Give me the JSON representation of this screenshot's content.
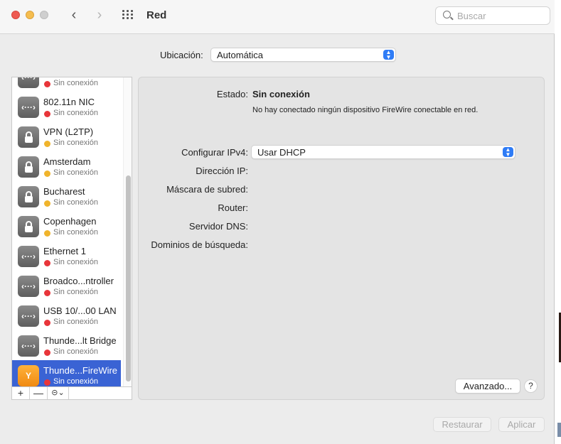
{
  "window": {
    "title": "Red"
  },
  "toolbar": {
    "back": "‹",
    "forward": "›",
    "search_placeholder": "Buscar"
  },
  "location": {
    "label": "Ubicación:",
    "value": "Automática"
  },
  "services": [
    {
      "name": "",
      "status": "Sin conexión",
      "dot": "red",
      "icon": "network"
    },
    {
      "name": "802.11n NIC",
      "status": "Sin conexión",
      "dot": "red",
      "icon": "network"
    },
    {
      "name": "VPN (L2TP)",
      "status": "Sin conexión",
      "dot": "yellow",
      "icon": "lock"
    },
    {
      "name": "Amsterdam",
      "status": "Sin conexión",
      "dot": "yellow",
      "icon": "lock"
    },
    {
      "name": "Bucharest",
      "status": "Sin conexión",
      "dot": "yellow",
      "icon": "lock"
    },
    {
      "name": "Copenhagen",
      "status": "Sin conexión",
      "dot": "yellow",
      "icon": "lock"
    },
    {
      "name": "Ethernet 1",
      "status": "Sin conexión",
      "dot": "red",
      "icon": "network"
    },
    {
      "name": "Broadco...ntroller",
      "status": "Sin conexión",
      "dot": "red",
      "icon": "network"
    },
    {
      "name": "USB 10/...00 LAN",
      "status": "Sin conexión",
      "dot": "red",
      "icon": "network"
    },
    {
      "name": "Thunde...lt Bridge",
      "status": "Sin conexión",
      "dot": "red",
      "icon": "network"
    },
    {
      "name": "Thunde...FireWire",
      "status": "Sin conexión",
      "dot": "red",
      "icon": "firewire",
      "selected": true
    }
  ],
  "icon_glyphs": {
    "network": "‹···›",
    "firewire": "Y"
  },
  "sidebar_footer": {
    "add": "+",
    "remove": "—",
    "action": "⊝⌄"
  },
  "detail": {
    "status_label": "Estado:",
    "status_value": "Sin conexión",
    "status_description": "No hay conectado ningún dispositivo FireWire conectable en red.",
    "configure_label": "Configurar IPv4:",
    "configure_value": "Usar DHCP",
    "ip_label": "Dirección IP:",
    "mask_label": "Máscara de subred:",
    "router_label": "Router:",
    "dns_label": "Servidor DNS:",
    "search_domains_label": "Dominios de búsqueda:",
    "advanced_button": "Avanzado...",
    "help_button": "?"
  },
  "footer": {
    "restore": "Restaurar",
    "apply": "Aplicar"
  },
  "colors": {
    "selection": "#3a63d4",
    "accent": "#2f7cf6",
    "status_red": "#e8353a",
    "status_yellow": "#f0b42c"
  }
}
